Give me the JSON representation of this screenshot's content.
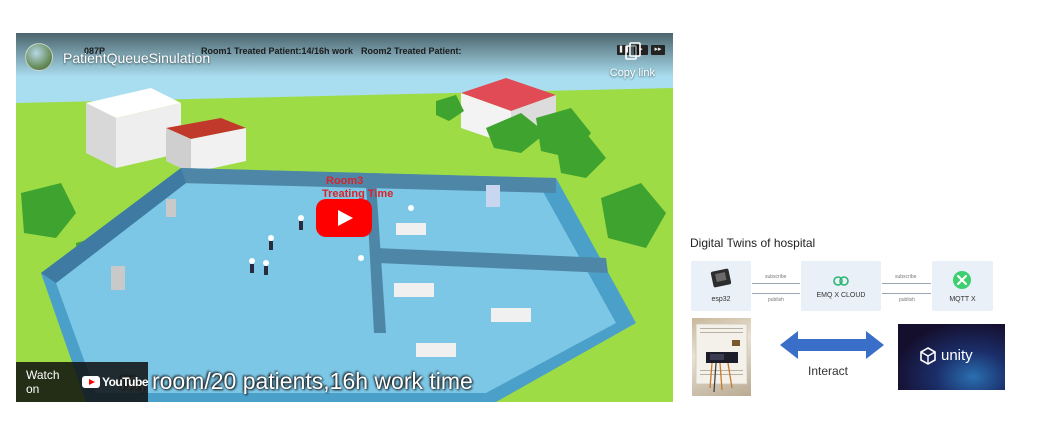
{
  "video": {
    "channel_title": "PatientQueueSinulation",
    "hud_time": "087P",
    "hud_room1": "Room1 Treated Patient:14/16h work",
    "hud_room2": "Room2 Treated Patient:",
    "copy_link_label": "Copy link",
    "scene_label_1": "Room3",
    "scene_label_2": "Treating Time",
    "watch_on_label": "Watch on",
    "youtube_label": "YouTube",
    "caption": "m, room/20 patients,16h work time"
  },
  "diagram": {
    "title": "Digital Twins  of  hospital",
    "esp32_label": "esp32",
    "subscribe_left": "subscribe",
    "publish_left": "publish",
    "emq_label": "EMQ X CLOUD",
    "subscribe_right": "subscribe",
    "publish_right": "publish",
    "mqtt_label": "MQTT X",
    "interact_label": "Interact",
    "unity_label": "unity",
    "colors": {
      "box_bg": "#e9f0f7",
      "arrow": "#3a6fc9",
      "emq_green": "#2bb673",
      "mqtt_green": "#3ccf6e",
      "unity_bg": "#1a1030"
    }
  }
}
